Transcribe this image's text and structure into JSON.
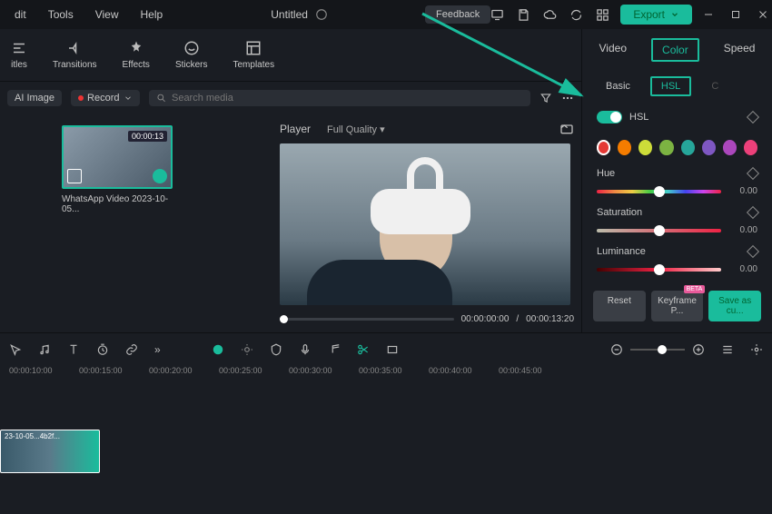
{
  "titlebar": {
    "menus": [
      "dit",
      "Tools",
      "View",
      "Help"
    ],
    "doc_title": "Untitled",
    "feedback": "Feedback",
    "export": "Export"
  },
  "tool_tabs": [
    {
      "label": "itles"
    },
    {
      "label": "Transitions"
    },
    {
      "label": "Effects"
    },
    {
      "label": "Stickers"
    },
    {
      "label": "Templates"
    }
  ],
  "search_row": {
    "ai_label": "AI Image",
    "record_label": "Record",
    "placeholder": "Search media"
  },
  "media": {
    "thumb": {
      "duration": "00:00:13",
      "name": "WhatsApp Video 2023-10-05..."
    }
  },
  "player": {
    "title": "Player",
    "quality": "Full Quality",
    "current": "00:00:00:00",
    "total": "00:00:13:20"
  },
  "inspector": {
    "tabs": [
      "Video",
      "Color",
      "Speed"
    ],
    "active_tab": "Color",
    "subtabs": [
      "Basic",
      "HSL",
      "C"
    ],
    "active_sub": "HSL",
    "hsl_label": "HSL",
    "colors": [
      "#e53935",
      "#f57c00",
      "#cddc39",
      "#7cb342",
      "#26a69a",
      "#7e57c2",
      "#ab47bc",
      "#ec407a"
    ],
    "sliders": [
      {
        "name": "Hue",
        "value": "0.00",
        "pos": 50,
        "grad": "hue-grad"
      },
      {
        "name": "Saturation",
        "value": "0.00",
        "pos": 50,
        "grad": "sat-grad"
      },
      {
        "name": "Luminance",
        "value": "0.00",
        "pos": 50,
        "grad": "lum-grad"
      }
    ],
    "buttons": {
      "reset": "Reset",
      "keyframe": "Keyframe P...",
      "save": "Save as cu...",
      "beta": "BETA"
    }
  },
  "timeline": {
    "marks": [
      "00:00:10:00",
      "00:00:15:00",
      "00:00:20:00",
      "00:00:25:00",
      "00:00:30:00",
      "00:00:35:00",
      "00:00:40:00",
      "00:00:45:00"
    ],
    "clip_label": "23-10-05...4b2f..."
  }
}
